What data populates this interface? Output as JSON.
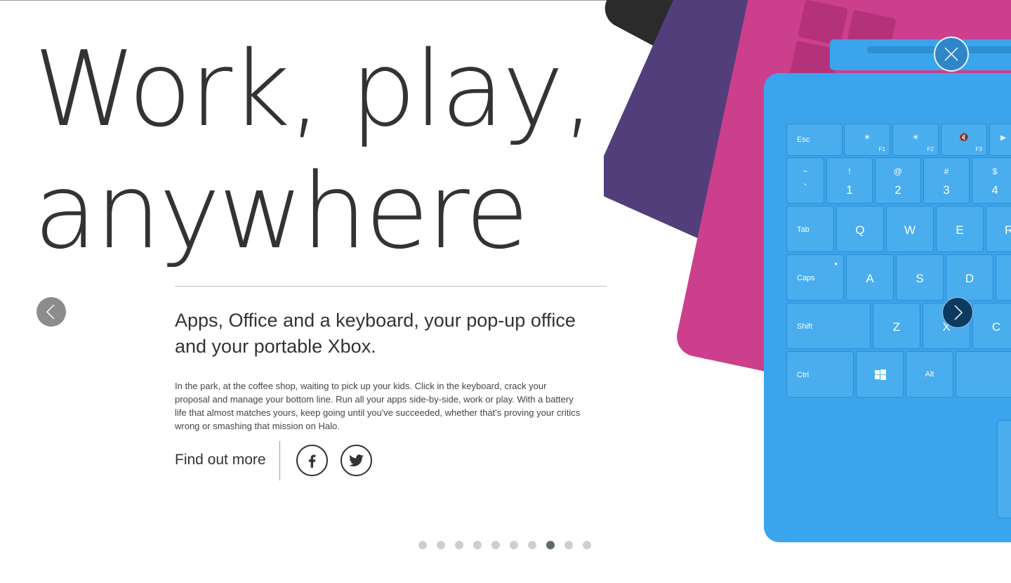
{
  "hero": {
    "headline_line1": "Work, play,",
    "headline_line2": "anywhere",
    "subheading": "Apps, Office and a keyboard, your pop-up office and your portable Xbox.",
    "body": "In the park, at the coffee shop, waiting to pick up your kids. Click in the keyboard, crack your proposal and manage your bottom line. Run all your apps side-by-side, work or play. With a battery life that almost matches yours, keep going until you've succeeded, whether that's proving your critics wrong or smashing that mission on Halo.",
    "cta_label": "Find out more"
  },
  "social": [
    {
      "name": "facebook-icon"
    },
    {
      "name": "twitter-icon"
    }
  ],
  "carousel": {
    "slide_count": 10,
    "active_index": 7,
    "prev_icon": "chevron-left-icon",
    "next_icon": "chevron-right-icon",
    "close_icon": "close-icon"
  },
  "keyboard": {
    "row_fn": [
      "Esc",
      "",
      "",
      ""
    ],
    "fn_labels": [
      "F1",
      "F2",
      "F3"
    ],
    "row_num_top": [
      "~",
      "!",
      "@",
      "#",
      "$"
    ],
    "row_num_bottom": [
      "`",
      "1",
      "2",
      "3",
      "4"
    ],
    "row_q": [
      "Tab",
      "Q",
      "W",
      "E",
      "R"
    ],
    "row_a": [
      "Caps",
      "A",
      "S",
      "D"
    ],
    "row_z": [
      "Shift",
      "Z",
      "X",
      "C"
    ],
    "row_ctrl": [
      "Ctrl",
      "",
      "Alt"
    ],
    "back_keys": [
      "Esc",
      "Shift",
      "Ctrl",
      "Cap"
    ]
  },
  "colors": {
    "cover_blue": "#3aa4ec",
    "pink": "#cc3f8d",
    "purple": "#533e7c",
    "black": "#2b2b2b",
    "dot_active": "#5a6b68",
    "dot_inactive": "#c9d2d0"
  }
}
